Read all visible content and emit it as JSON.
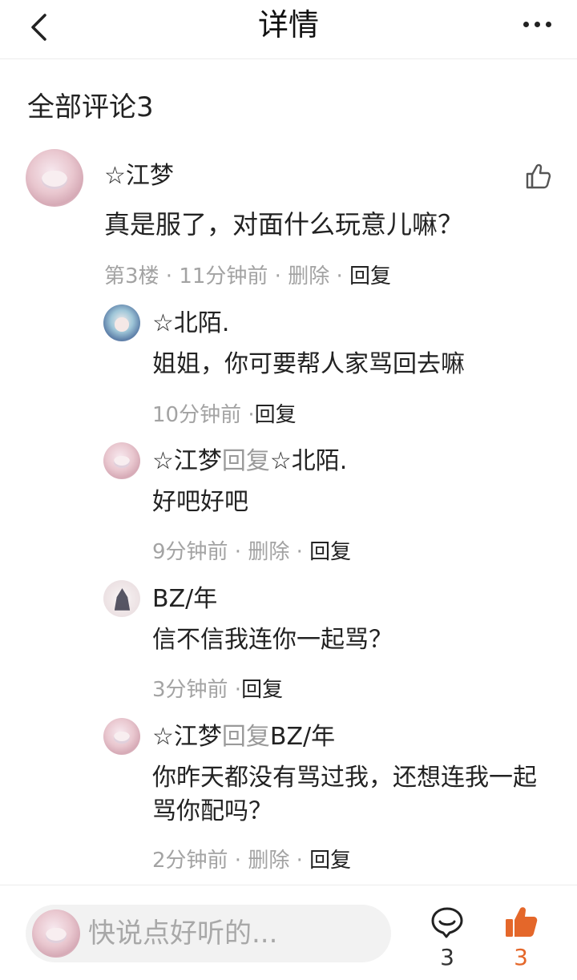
{
  "header": {
    "title": "详情"
  },
  "section": {
    "title": "全部评论3"
  },
  "comment": {
    "author": "☆江梦",
    "text": "真是服了，对面什么玩意儿嘛？",
    "meta": "第3楼 · 11分钟前 · 删除 · ",
    "reply_action": "回复"
  },
  "replies": [
    {
      "author": "☆北陌.",
      "reply_word": "",
      "target": "",
      "text": "姐姐，你可要帮人家骂回去嘛",
      "meta": "10分钟前 ·",
      "action": "回复"
    },
    {
      "author": "☆江梦",
      "reply_word": "回复",
      "target": "☆北陌.",
      "text": "好吧好吧",
      "meta": "9分钟前 · 删除 · ",
      "action": "回复"
    },
    {
      "author": "BZ/年",
      "reply_word": "",
      "target": "",
      "text": "信不信我连你一起骂？",
      "meta": "3分钟前 ·",
      "action": "回复"
    },
    {
      "author": "☆江梦",
      "reply_word": "回复",
      "target": "BZ/年",
      "text": "你昨天都没有骂过我，还想连我一起骂你配吗？",
      "meta": "2分钟前 · 删除 · ",
      "action": "回复"
    }
  ],
  "bottom_bar": {
    "placeholder": "快说点好听的...",
    "comment_count": "3",
    "like_count": "3"
  },
  "colors": {
    "accent": "#e4672a",
    "muted": "#a3a3a3",
    "text": "#222222"
  },
  "icons": [
    "back-arrow-icon",
    "more-icon",
    "thumbs-up-icon",
    "comment-bubble-icon",
    "thumbs-up-filled-icon"
  ]
}
